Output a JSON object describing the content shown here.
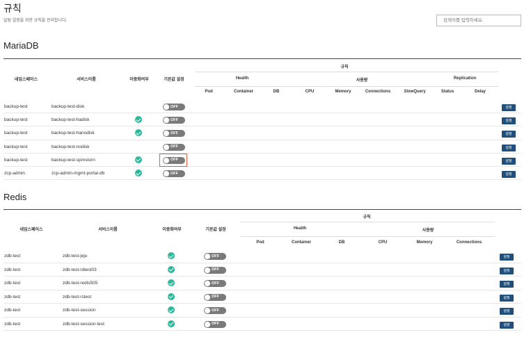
{
  "page": {
    "title": "규칙",
    "description": "알림 설정을 위한 규칙을 관리합니다.",
    "search_placeholder": "검색어를 입력하세요."
  },
  "mariadb": {
    "title": "MariaDB",
    "headers": {
      "namespace": "네임스페이스",
      "service": "서비스이름",
      "redundancy": "이중화여부",
      "default": "기본값 설정",
      "rules": "규칙",
      "health": "Health",
      "usage": "사용량",
      "replication": "Replication",
      "pod": "Pod",
      "container": "Container",
      "db": "DB",
      "cpu": "CPU",
      "memory": "Memory",
      "connections": "Connections",
      "slowquery": "SlowQuery",
      "status": "Status",
      "delay": "Delay"
    },
    "rows": [
      {
        "namespace": "backup-test",
        "service": "backup-test-disk",
        "redundant": false,
        "toggle": "OFF",
        "button": "설정"
      },
      {
        "namespace": "backup-test",
        "service": "backup-test-hadisk",
        "redundant": true,
        "toggle": "OFF",
        "button": "설정"
      },
      {
        "namespace": "backup-test",
        "service": "backup-test-hanodisk",
        "redundant": true,
        "toggle": "OFF",
        "button": "설정"
      },
      {
        "namespace": "backup-test",
        "service": "backup-test-nodisk",
        "redundant": false,
        "toggle": "OFF",
        "button": "설정"
      },
      {
        "namespace": "backup-test",
        "service": "backup-test-sprnstorn",
        "redundant": true,
        "toggle": "OFF",
        "button": "설정",
        "highlighted": true
      },
      {
        "namespace": "zcp-admin",
        "service": "zcp-admin-mgmt-portal-db",
        "redundant": true,
        "toggle": "OFF",
        "button": "설정"
      }
    ]
  },
  "redis": {
    "title": "Redis",
    "headers": {
      "namespace": "네임스페이스",
      "service": "서비스이름",
      "redundancy": "이중화여부",
      "default": "기본값 설정",
      "rules": "규칙",
      "health": "Health",
      "usage": "사용량",
      "pod": "Pod",
      "container": "Container",
      "db": "DB",
      "cpu": "CPU",
      "memory": "Memory",
      "connections": "Connections"
    },
    "rows": [
      {
        "namespace": "zdb-test",
        "service": "zdb-test-jeju",
        "redundant": true,
        "toggle": "OFF",
        "button": "설정"
      },
      {
        "namespace": "zdb-test",
        "service": "zdb-test-rdtest03",
        "redundant": true,
        "toggle": "OFF",
        "button": "설정"
      },
      {
        "namespace": "zdb-test",
        "service": "zdb-test-redis505",
        "redundant": true,
        "toggle": "OFF",
        "button": "설정"
      },
      {
        "namespace": "zdb-test",
        "service": "zdb-test-rstest",
        "redundant": true,
        "toggle": "OFF",
        "button": "설정"
      },
      {
        "namespace": "zdb-test",
        "service": "zdb-test-session",
        "redundant": true,
        "toggle": "OFF",
        "button": "설정"
      },
      {
        "namespace": "zdb-test",
        "service": "zdb-test-session-test",
        "redundant": true,
        "toggle": "OFF",
        "button": "설정"
      }
    ]
  },
  "colors": {
    "check": "#2bb89a",
    "toggle_off": "#7a7a7a",
    "button": "#1f4f7a",
    "highlight": "#e05a3a"
  }
}
